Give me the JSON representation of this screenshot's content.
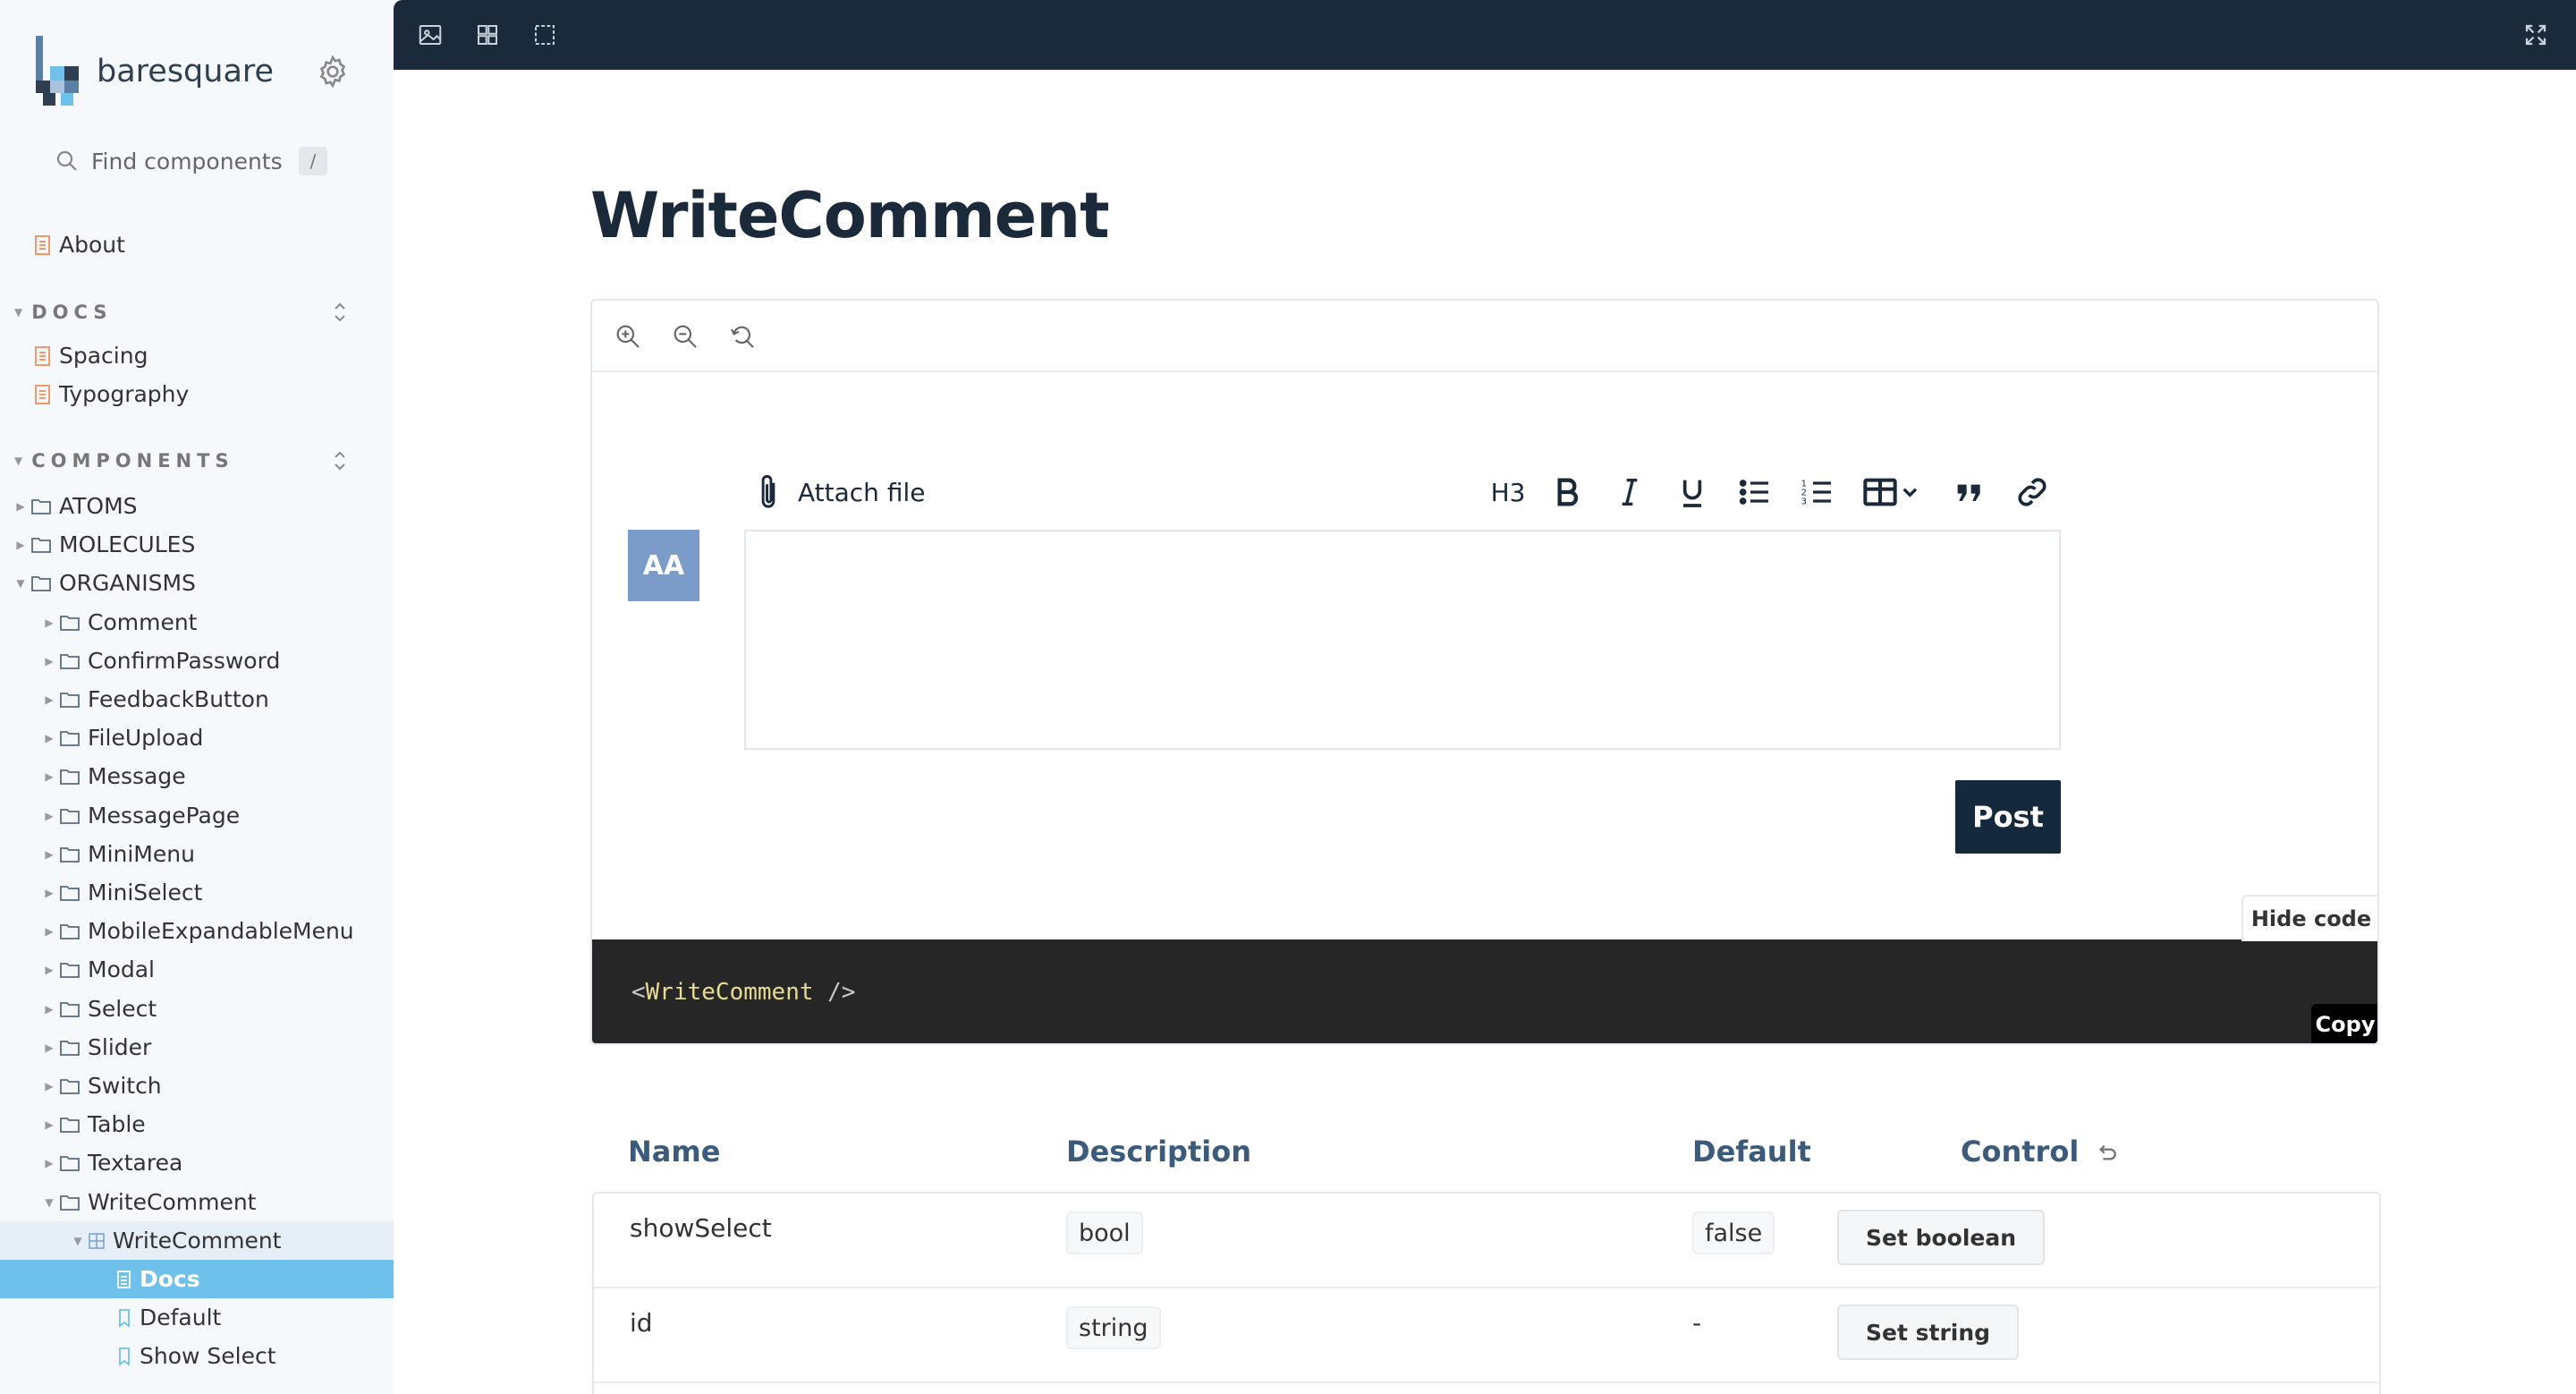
{
  "brand": {
    "name": "baresquare"
  },
  "search": {
    "placeholder": "Find components",
    "shortcut": "/"
  },
  "nav": {
    "about": "About",
    "docs_section": "DOCS",
    "docs": [
      "Spacing",
      "Typography"
    ],
    "components_section": "COMPONENTS",
    "groups": [
      "ATOMS",
      "MOLECULES",
      "ORGANISMS"
    ],
    "organisms": [
      "Comment",
      "ConfirmPassword",
      "FeedbackButton",
      "FileUpload",
      "Message",
      "MessagePage",
      "MiniMenu",
      "MiniSelect",
      "MobileExpandableMenu",
      "Modal",
      "Select",
      "Slider",
      "Switch",
      "Table",
      "Textarea",
      "WriteComment"
    ],
    "component": "WriteComment",
    "stories": [
      "Docs",
      "Default",
      "Show Select"
    ]
  },
  "page": {
    "title": "WriteComment"
  },
  "preview": {
    "attach_label": "Attach file",
    "h3_label": "H3",
    "avatar_initials": "AA",
    "post_label": "Post",
    "hide_code_label": "Hide code",
    "code_open": "<",
    "code_tag": "WriteComment",
    "code_close": " />",
    "copy_label": "Copy"
  },
  "props_table": {
    "headers": {
      "name": "Name",
      "description": "Description",
      "default": "Default",
      "control": "Control"
    },
    "rows": [
      {
        "name": "showSelect",
        "type": "bool",
        "default": "false",
        "control": "Set boolean"
      },
      {
        "name": "id",
        "type": "string",
        "default": "-",
        "control": "Set string"
      }
    ]
  },
  "colors": {
    "topbar": "#1a2a3a",
    "selected": "#6ec1ea",
    "post_button": "#15293c",
    "avatar": "#7b9cc9",
    "code_bg": "#262626"
  }
}
